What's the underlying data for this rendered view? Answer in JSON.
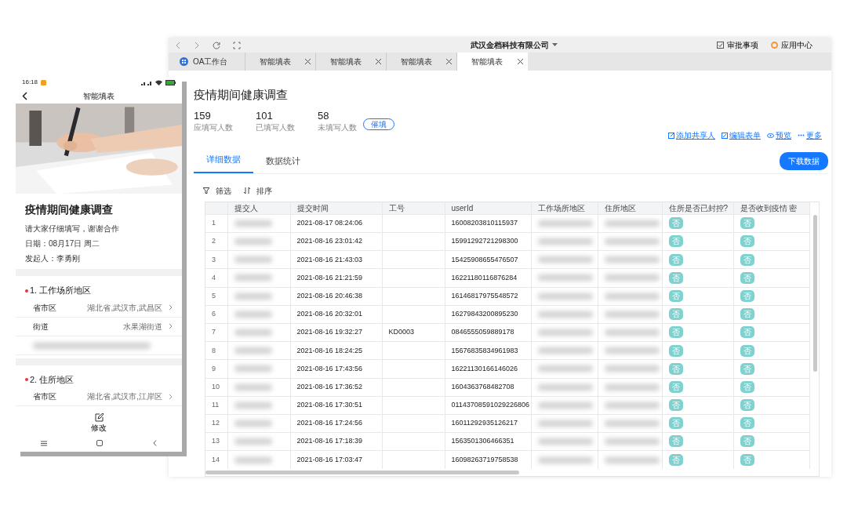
{
  "window": {
    "title": "武汉金档科技有限公司",
    "actions": [
      {
        "label": "审批事项",
        "kind": "check"
      },
      {
        "label": "应用中心",
        "kind": "apps"
      }
    ],
    "tabs": [
      {
        "label": "OA工作台",
        "kind": "home",
        "selected": false
      },
      {
        "label": "智能填表",
        "kind": "doc",
        "selected": false
      },
      {
        "label": "智能填表",
        "kind": "doc",
        "selected": false
      },
      {
        "label": "智能填表",
        "kind": "doc",
        "selected": false
      },
      {
        "label": "智能填表",
        "kind": "doc",
        "selected": true
      }
    ]
  },
  "page": {
    "title": "疫情期间健康调查",
    "stats": [
      {
        "value": "159",
        "label": "应填写人数"
      },
      {
        "value": "101",
        "label": "已填写人数"
      },
      {
        "value": "58",
        "label": "未填写人数"
      }
    ],
    "remind_button": "催填",
    "links": [
      {
        "label": "添加共享人",
        "kind": "share"
      },
      {
        "label": "编辑表单",
        "kind": "edit"
      },
      {
        "label": "预览",
        "kind": "eye"
      },
      {
        "label": "更多",
        "kind": "more"
      }
    ],
    "view_tabs": [
      {
        "label": "详细数据",
        "selected": true
      },
      {
        "label": "数据统计",
        "selected": false
      }
    ],
    "download_button": "下载数据",
    "tools": [
      {
        "label": "筛选",
        "kind": "filter"
      },
      {
        "label": "排序",
        "kind": "sort"
      }
    ],
    "table": {
      "columns": [
        "提交人",
        "提交时间",
        "工号",
        "userId",
        "工作场所地区",
        "住所地区",
        "住所是否已封控?",
        "是否收到疫情 密"
      ],
      "rows": [
        {
          "index": "1",
          "time": "2021-08-17 08:24:06",
          "employee_id": "",
          "user_id": "16008203810115937",
          "sealed": "否",
          "contact": "否"
        },
        {
          "index": "2",
          "time": "2021-08-16 23:01:42",
          "employee_id": "",
          "user_id": "15991292721298300",
          "sealed": "否",
          "contact": "否"
        },
        {
          "index": "3",
          "time": "2021-08-16 21:43:03",
          "employee_id": "",
          "user_id": "15425908655476507",
          "sealed": "否",
          "contact": "否"
        },
        {
          "index": "4",
          "time": "2021-08-16 21:21:59",
          "employee_id": "",
          "user_id": "16221180116876284",
          "sealed": "否",
          "contact": "否"
        },
        {
          "index": "5",
          "time": "2021-08-16 20:46:38",
          "employee_id": "",
          "user_id": "16146817975548572",
          "sealed": "否",
          "contact": "否"
        },
        {
          "index": "6",
          "time": "2021-08-16 20:32:01",
          "employee_id": "",
          "user_id": "16279843200895230",
          "sealed": "否",
          "contact": "否"
        },
        {
          "index": "7",
          "time": "2021-08-16 19:32:27",
          "employee_id": "KD0003",
          "user_id": "0846555059889178",
          "sealed": "否",
          "contact": "否"
        },
        {
          "index": "8",
          "time": "2021-08-16 18:24:25",
          "employee_id": "",
          "user_id": "15676835834961983",
          "sealed": "否",
          "contact": "否"
        },
        {
          "index": "9",
          "time": "2021-08-16 17:43:56",
          "employee_id": "",
          "user_id": "16221130166146026",
          "sealed": "否",
          "contact": "否"
        },
        {
          "index": "10",
          "time": "2021-08-16 17:36:52",
          "employee_id": "",
          "user_id": "1604363768482708",
          "sealed": "否",
          "contact": "否"
        },
        {
          "index": "11",
          "time": "2021-08-16 17:30:51",
          "employee_id": "",
          "user_id": "01143708591029226806",
          "sealed": "否",
          "contact": "否"
        },
        {
          "index": "12",
          "time": "2021-08-16 17:24:56",
          "employee_id": "",
          "user_id": "16011292935126217",
          "sealed": "否",
          "contact": "否"
        },
        {
          "index": "13",
          "time": "2021-08-16 17:18:39",
          "employee_id": "",
          "user_id": "1563501306466351",
          "sealed": "否",
          "contact": "否"
        },
        {
          "index": "14",
          "time": "2021-08-16 17:03:47",
          "employee_id": "",
          "user_id": "16098263719758538",
          "sealed": "否",
          "contact": "否"
        }
      ]
    }
  },
  "phone": {
    "time": "16:18",
    "title": "智能填表",
    "heading": "疫情期间健康调查",
    "description": "请大家仔细填写，谢谢合作",
    "date": "日期：08月17日 周二",
    "initiator": "发起人：李勇刚",
    "questions": [
      {
        "label": "1. 工作场所地区",
        "required": true,
        "fields": [
          {
            "label": "省市区",
            "value": "湖北省,武汉市,武昌区"
          },
          {
            "label": "街道",
            "value": "水果湖街道"
          }
        ]
      },
      {
        "label": "2. 住所地区",
        "required": true,
        "fields": [
          {
            "label": "省市区",
            "value": "湖北省,武汉市,江岸区"
          }
        ]
      }
    ],
    "edit_label": "修改"
  }
}
